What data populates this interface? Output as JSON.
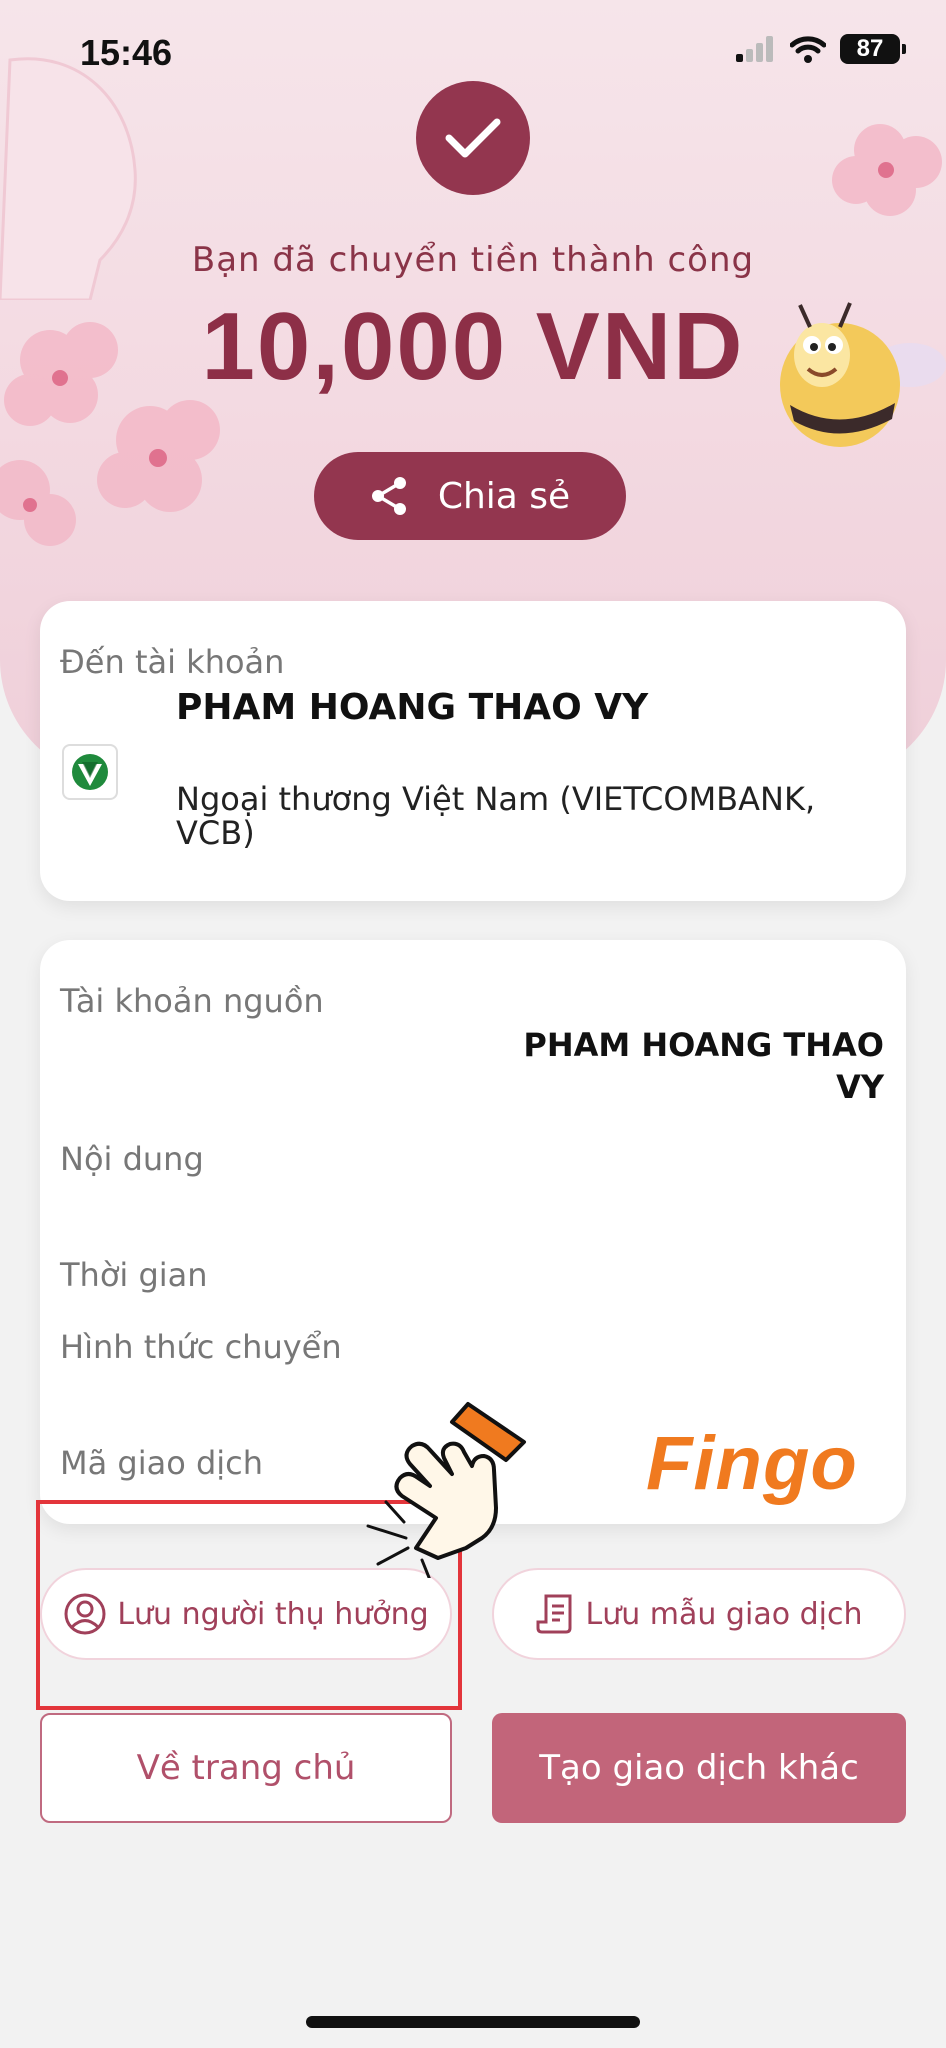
{
  "status_bar": {
    "time": "15:46",
    "battery": "87"
  },
  "hero": {
    "success_message": "Bạn đã chuyển tiền thành công",
    "amount": "10,000 VND",
    "share_label": "Chia sẻ"
  },
  "destination": {
    "label": "Đến tài khoản",
    "name": "PHAM HOANG THAO VY",
    "bank": "Ngoại thương Việt Nam (VIETCOMBANK, VCB)"
  },
  "details": {
    "source_label": "Tài khoản nguồn",
    "source_name_line1": "PHAM HOANG THAO",
    "source_name_line2": "VY",
    "content_label": "Nội dung",
    "time_label": "Thời gian",
    "method_label": "Hình thức chuyển",
    "transaction_id_label": "Mã giao dịch",
    "brand": "Fingo"
  },
  "actions": {
    "save_beneficiary": "Lưu người thụ hưởng",
    "save_template": "Lưu mẫu giao dịch",
    "home": "Về trang chủ",
    "new_transaction": "Tạo giao dịch khác"
  },
  "colors": {
    "primary": "#93364f",
    "accent": "#c2657a",
    "highlight": "#e3353b",
    "brand": "#f07a1f"
  }
}
